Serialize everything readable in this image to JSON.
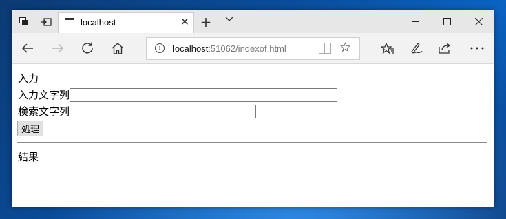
{
  "browser": {
    "tab_title": "localhost",
    "address_host": "localhost",
    "address_path": ":51062/indexof.html"
  },
  "page": {
    "heading": "入力",
    "input_label": "入力文字列",
    "input_value": "",
    "search_label": "検索文字列",
    "search_value": "",
    "process_button": "処理",
    "result_heading": "結果"
  },
  "icons": {
    "tab_actions": "tab-actions-icon",
    "set_aside": "set-aside-tabs-icon",
    "tab_page": "page-icon",
    "close": "close-icon",
    "new_tab": "plus-icon",
    "tab_list": "chevron-down-icon",
    "minimize": "minimize-icon",
    "maximize": "maximize-icon",
    "window_close": "close-icon",
    "back": "arrow-left-icon",
    "forward": "arrow-right-icon",
    "refresh": "refresh-icon",
    "home": "home-icon",
    "info": "info-icon",
    "reading_view": "reading-view-icon",
    "favorite": "star-icon",
    "favorites_hub": "favorites-icon",
    "notes": "pen-icon",
    "share": "share-icon",
    "more": "more-icon"
  }
}
